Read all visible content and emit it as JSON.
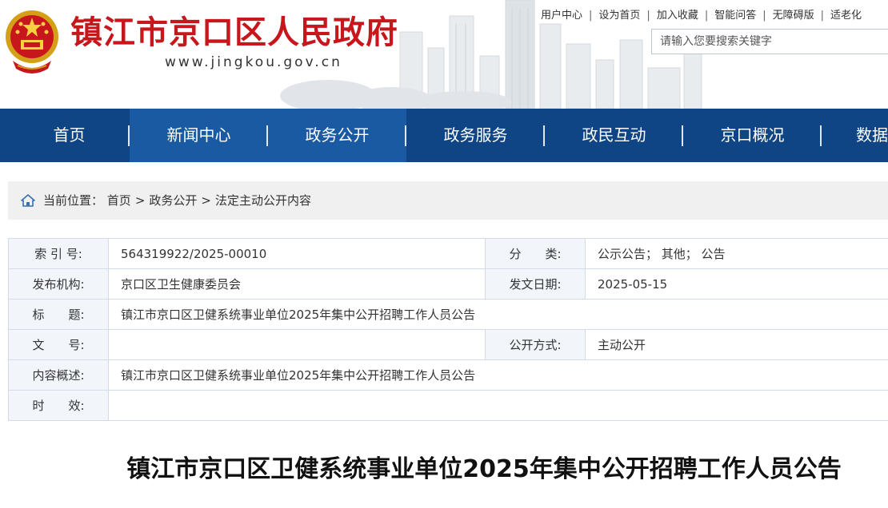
{
  "header": {
    "title": "镇江市京口区人民政府",
    "url": "www.jingkou.gov.cn",
    "top_links": [
      "用户中心",
      "设为首页",
      "加入收藏",
      "智能问答",
      "无障碍版",
      "适老化"
    ],
    "search_placeholder": "请输入您要搜索关键字",
    "emblem_icon": "national-emblem-icon"
  },
  "nav": {
    "items": [
      "首页",
      "新闻中心",
      "政务公开",
      "政务服务",
      "政民互动",
      "京口概况",
      "数据"
    ],
    "active_index": 2
  },
  "breadcrumb": {
    "label": "当前位置：",
    "items": [
      "首页",
      "政务公开",
      "法定主动公开内容"
    ],
    "separator": ">",
    "icon": "home-icon"
  },
  "info": {
    "index_label": "索 引 号:",
    "index_value": "564319922/2025-00010",
    "category_label": "分　　类:",
    "category_value": "公示公告；  其他；  公告",
    "publisher_label": "发布机构:",
    "publisher_value": "京口区卫生健康委员会",
    "date_label": "发文日期:",
    "date_value": "2025-05-15",
    "title_label": "标　　题:",
    "title_value": "镇江市京口区卫健系统事业单位2025年集中公开招聘工作人员公告",
    "docno_label": "文　　号:",
    "docno_value": "",
    "mode_label": "公开方式:",
    "mode_value": "主动公开",
    "summary_label": "内容概述:",
    "summary_value": "镇江市京口区卫健系统事业单位2025年集中公开招聘工作人员公告",
    "validity_label": "时　　效:",
    "validity_value": ""
  },
  "article": {
    "title": "镇江市京口区卫健系统事业单位2025年集中公开招聘工作人员公告"
  },
  "colors": {
    "nav_bg": "#0f4584",
    "nav_active": "#1a5aa3",
    "brand_red": "#c8161d",
    "table_label_bg": "#f2f6fb"
  }
}
